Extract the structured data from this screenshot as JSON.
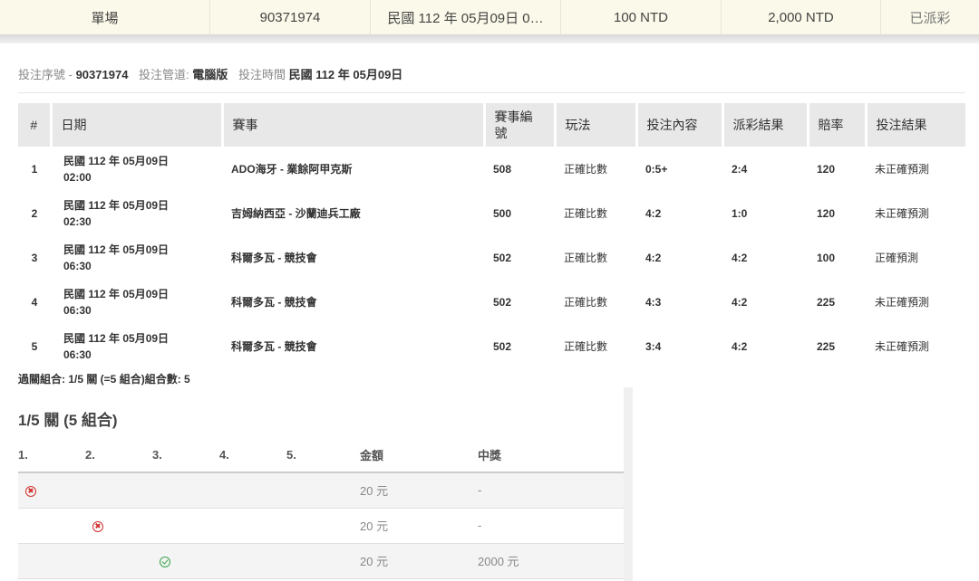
{
  "summary": {
    "type": "單場",
    "serial": "90371974",
    "time": "民國 112 年 05月09日 0…",
    "stake": "100 NTD",
    "payout": "2,000 NTD",
    "status": "已派彩"
  },
  "meta": {
    "serial_label": "投注序號 -",
    "serial_value": "90371974",
    "channel_label": "投注管道:",
    "channel_value": "電腦版",
    "time_label": "投注時間",
    "time_value": "民國 112 年 05月09日"
  },
  "bets": {
    "headers": [
      "#",
      "日期",
      "賽事",
      "賽事編號",
      "玩法",
      "投注內容",
      "派彩結果",
      "賠率",
      "投注結果"
    ],
    "rows": [
      {
        "no": "1",
        "date1": "民國 112 年 05月09日",
        "date2": "02:00",
        "match": "ADO海牙 - 業餘阿甲克斯",
        "match_no": "508",
        "play": "正確比數",
        "pick": "0:5+",
        "result": "2:4",
        "odds": "120",
        "outcome": "未正確預測"
      },
      {
        "no": "2",
        "date1": "民國 112 年 05月09日",
        "date2": "02:30",
        "match": "吉姆納西亞 - 沙蘭迪兵工廠",
        "match_no": "500",
        "play": "正確比數",
        "pick": "4:2",
        "result": "1:0",
        "odds": "120",
        "outcome": "未正確預測"
      },
      {
        "no": "3",
        "date1": "民國 112 年 05月09日",
        "date2": "06:30",
        "match": "科爾多瓦 - 競技會",
        "match_no": "502",
        "play": "正確比數",
        "pick": "4:2",
        "result": "4:2",
        "odds": "100",
        "outcome": "正確預測"
      },
      {
        "no": "4",
        "date1": "民國 112 年 05月09日",
        "date2": "06:30",
        "match": "科爾多瓦 - 競技會",
        "match_no": "502",
        "play": "正確比數",
        "pick": "4:3",
        "result": "4:2",
        "odds": "225",
        "outcome": "未正確預測"
      },
      {
        "no": "5",
        "date1": "民國 112 年 05月09日",
        "date2": "06:30",
        "match": "科爾多瓦 - 競技會",
        "match_no": "502",
        "play": "正確比數",
        "pick": "3:4",
        "result": "4:2",
        "odds": "225",
        "outcome": "未正確預測"
      }
    ]
  },
  "parlay_note": "過關組合: 1/5 關 (=5 組合)組合數: 5",
  "combo": {
    "title": "1/5 關 (5 組合)",
    "headers": [
      "1.",
      "2.",
      "3.",
      "4.",
      "5.",
      "金額",
      "中獎"
    ],
    "rows": [
      {
        "amount": "20 元",
        "prize": "-",
        "icon": "x-circle-icon",
        "col": 1
      },
      {
        "amount": "20 元",
        "prize": "-",
        "icon": "x-circle-icon",
        "col": 2
      },
      {
        "amount": "20 元",
        "prize": "2000 元",
        "icon": "check-circle-icon",
        "col": 3
      }
    ]
  },
  "colors": {
    "lose": "#d0312d",
    "win": "#37a34a",
    "summary_bg": "#fbf9e9",
    "header_bg": "#e8e8e8"
  }
}
